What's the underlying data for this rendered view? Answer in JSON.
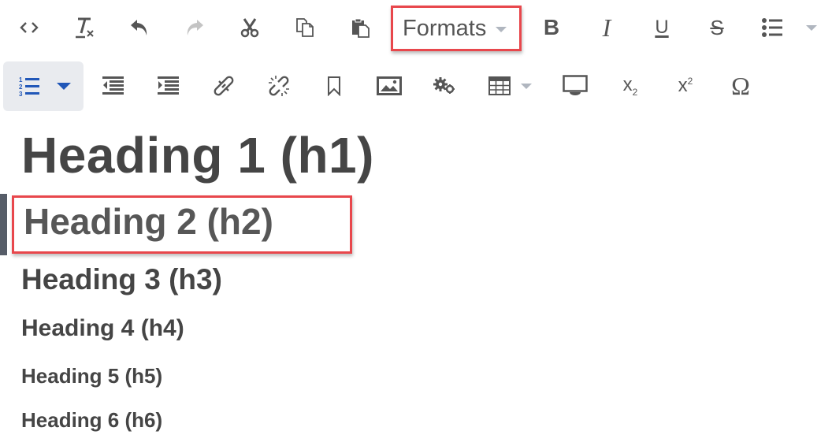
{
  "toolbar": {
    "row1": [
      {
        "name": "source-code",
        "icon": "code-icon",
        "tooltip": "Source code"
      },
      {
        "name": "clear-formatting",
        "icon": "remove-format-icon",
        "tooltip": "Clear formatting"
      },
      {
        "name": "undo",
        "icon": "undo-icon",
        "tooltip": "Undo"
      },
      {
        "name": "redo",
        "icon": "redo-icon",
        "tooltip": "Redo",
        "disabled": true
      },
      {
        "name": "cut",
        "icon": "scissors-icon",
        "tooltip": "Cut"
      },
      {
        "name": "copy",
        "icon": "copy-icon",
        "tooltip": "Copy"
      },
      {
        "name": "paste",
        "icon": "paste-icon",
        "tooltip": "Paste"
      }
    ],
    "formats_label": "Formats",
    "bold_label": "B",
    "italic_label": "I",
    "underline_label": "U",
    "strike_label": "S",
    "subscript_label": "x",
    "subscript_mark": "2",
    "superscript_label": "x",
    "superscript_mark": "2",
    "omega_label": "Ω",
    "ordered_list_numbers": [
      "1",
      "2",
      "3"
    ]
  },
  "colors": {
    "highlight_border": "#e8474c",
    "active_accent": "#2157b8",
    "icon": "#555555",
    "icon_disabled": "#c4c4c4",
    "heading_text": "#454545",
    "active_button_bg": "#e9ebef",
    "left_marker": "#565d68"
  },
  "content": {
    "headings": [
      {
        "level": "h1",
        "text": "Heading 1 (h1)"
      },
      {
        "level": "h2",
        "text": "Heading 2 (h2)",
        "highlighted": true
      },
      {
        "level": "h3",
        "text": "Heading 3 (h3)"
      },
      {
        "level": "h4",
        "text": "Heading 4 (h4)"
      },
      {
        "level": "h5",
        "text": "Heading 5 (h5)"
      },
      {
        "level": "h6",
        "text": "Heading 6 (h6)"
      }
    ]
  }
}
